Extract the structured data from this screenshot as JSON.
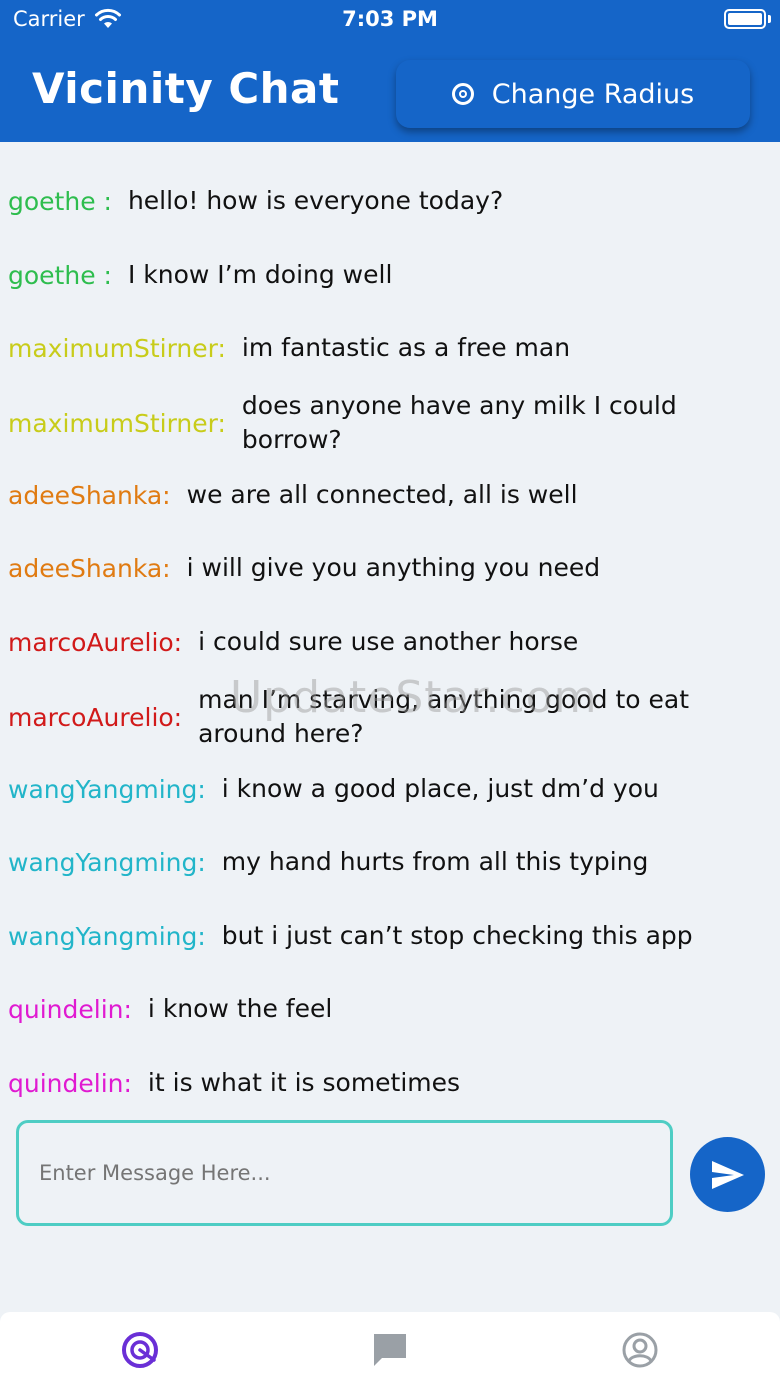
{
  "status_bar": {
    "carrier": "Carrier",
    "time": "7:03 PM"
  },
  "header": {
    "title": "Vicinity Chat",
    "change_radius_label": "Change Radius"
  },
  "colors": {
    "primary": "#1565c8",
    "input_border": "#4ecdc4",
    "text": "#111111"
  },
  "messages": [
    {
      "user": "goethe :",
      "text": "hello! how is everyone today?",
      "color": "#2ebd4e"
    },
    {
      "user": "goethe :",
      "text": "I know I’m doing well",
      "color": "#2ebd4e"
    },
    {
      "user": "maximumStirner:",
      "text": "im fantastic as a free man",
      "color": "#c8cc1a"
    },
    {
      "user": "maximumStirner:",
      "text": "does anyone have any milk I could borrow?",
      "color": "#c8cc1a"
    },
    {
      "user": "adeeShanka:",
      "text": "we are all connected, all is well",
      "color": "#e07b12"
    },
    {
      "user": "adeeShanka:",
      "text": "i will give you anything you need",
      "color": "#e07b12"
    },
    {
      "user": "marcoAurelio:",
      "text": "i could sure use another horse",
      "color": "#d11a1a"
    },
    {
      "user": "marcoAurelio:",
      "text": "man I’m starving, anything good to eat around here?",
      "color": "#d11a1a"
    },
    {
      "user": "wangYangming:",
      "text": "i know a good place, just dm’d you",
      "color": "#22b5c9"
    },
    {
      "user": "wangYangming:",
      "text": "my hand hurts from all this typing",
      "color": "#22b5c9"
    },
    {
      "user": "wangYangming:",
      "text": "but i just can’t stop checking this app",
      "color": "#22b5c9"
    },
    {
      "user": "quindelin:",
      "text": "i know the feel",
      "color": "#e01ad1"
    },
    {
      "user": "quindelin:",
      "text": "it is what it is sometimes",
      "color": "#e01ad1"
    }
  ],
  "watermark": "UpdateStar.com",
  "composer": {
    "placeholder": "Enter Message Here..."
  },
  "nav": {
    "items": [
      {
        "icon": "radar-icon",
        "active": true
      },
      {
        "icon": "chat-bubble-icon",
        "active": false
      },
      {
        "icon": "profile-icon",
        "active": false
      }
    ]
  }
}
